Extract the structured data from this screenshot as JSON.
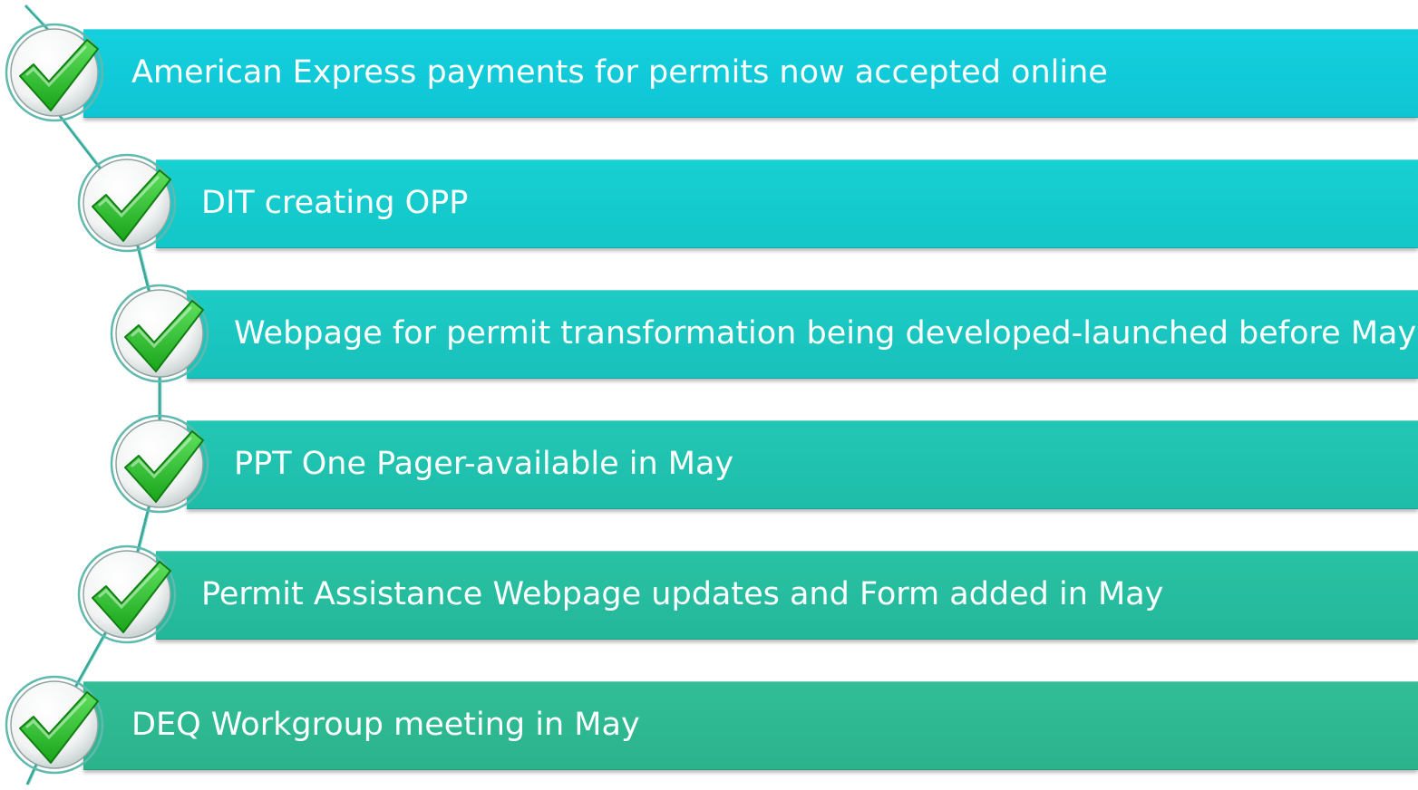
{
  "items": [
    {
      "label": "American Express payments for permits now accepted online",
      "status": "complete"
    },
    {
      "label": "DIT creating OPP",
      "status": "complete"
    },
    {
      "label": "Webpage for permit transformation being developed-launched before May",
      "status": "complete"
    },
    {
      "label": "PPT One Pager-available in May",
      "status": "complete"
    },
    {
      "label": "Permit Assistance Webpage updates and Form added in May",
      "status": "complete"
    },
    {
      "label": "DEQ Workgroup meeting in May",
      "status": "complete"
    }
  ],
  "icon": "checkmark-icon",
  "colors": {
    "band_top": "#14d0de",
    "band_bottom": "#2bb38c",
    "check_green": "#1aa51a",
    "connector": "#3aa89a"
  }
}
